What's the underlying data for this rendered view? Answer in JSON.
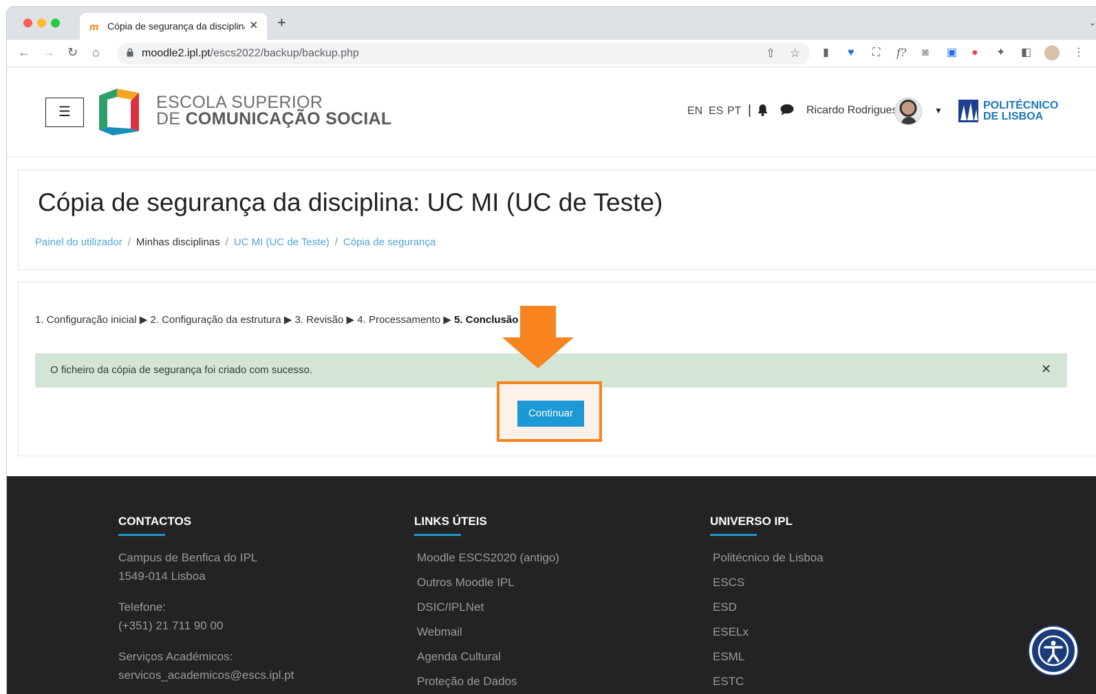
{
  "browser": {
    "tab_title": "Cópia de segurança da disciplina",
    "tab_favicon": "m",
    "url_host": "moodle2.ipl.pt",
    "url_path": "/escs2022/backup/backup.php"
  },
  "header": {
    "menu_icon": "☰",
    "logo_line1": "ESCOLA SUPERIOR",
    "logo_line2_prefix": "DE ",
    "logo_line2_bold": "COMUNICAÇÃO SOCIAL",
    "languages": [
      "EN",
      "ES",
      "PT"
    ],
    "user_name": "Ricardo Rodrigues",
    "ipl_line1": "POLITÉCNICO",
    "ipl_line2": "DE LISBOA"
  },
  "main": {
    "title": "Cópia de segurança da disciplina: UC MI (UC de Teste)",
    "breadcrumb": [
      {
        "label": "Painel do utilizador",
        "link": true
      },
      {
        "label": "Minhas disciplinas",
        "link": false
      },
      {
        "label": "UC MI (UC de Teste)",
        "link": true
      },
      {
        "label": "Cópia de segurança",
        "link": true
      }
    ],
    "steps": [
      "1. Configuração inicial",
      "2. Configuração da estrutura",
      "3. Revisão",
      "4. Processamento",
      "5. Conclusão"
    ],
    "step_arrow": "▶",
    "alert_text": "O ficheiro da cópia de segurança foi criado com sucesso.",
    "continue_label": "Continuar"
  },
  "footer": {
    "contacts_title": "CONTACTOS",
    "contacts_lines": [
      "Campus de Benfica do IPL",
      "1549-014 Lisboa",
      "Telefone:",
      "(+351) 21 711 90 00",
      "Serviços Académicos:",
      "servicos_academicos@escs.ipl.pt"
    ],
    "links_title": "LINKS ÚTEIS",
    "links": [
      "Moodle ESCS2020 (antigo)",
      "Outros Moodle IPL",
      "DSIC/IPLNet",
      "Webmail",
      "Agenda Cultural",
      "Proteção de Dados"
    ],
    "universe_title": "UNIVERSO IPL",
    "universe": [
      "Politécnico de Lisboa",
      "ESCS",
      "ESD",
      "ESELx",
      "ESML",
      "ESTC"
    ]
  },
  "colors": {
    "accent": "#1c98d4",
    "highlight": "#f7841e",
    "alert_bg": "#d3e6d6",
    "footer_bg": "#232323"
  }
}
